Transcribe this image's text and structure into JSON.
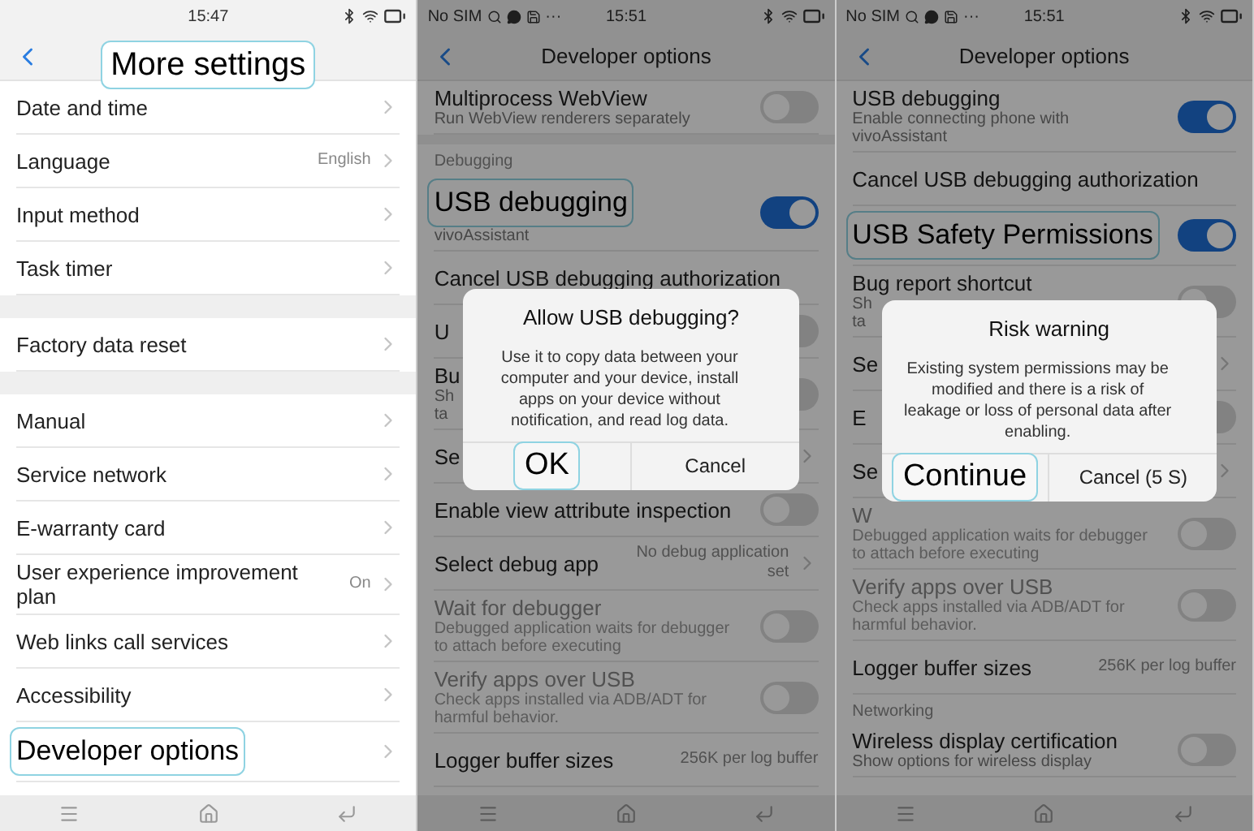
{
  "panels": [
    {
      "status": {
        "time": "15:47"
      },
      "header": {
        "title": "More settings",
        "highlighted": true
      },
      "dimmed": false,
      "rows": [
        {
          "kind": "link",
          "title": "Date and time"
        },
        {
          "kind": "link",
          "title": "Language",
          "value": "English"
        },
        {
          "kind": "link",
          "title": "Input method"
        },
        {
          "kind": "link",
          "title": "Task timer"
        },
        {
          "kind": "spacer"
        },
        {
          "kind": "link",
          "title": "Factory data reset"
        },
        {
          "kind": "spacer"
        },
        {
          "kind": "link",
          "title": "Manual"
        },
        {
          "kind": "link",
          "title": "Service network"
        },
        {
          "kind": "link",
          "title": "E-warranty card"
        },
        {
          "kind": "link",
          "title": "User experience improvement plan",
          "value": "On"
        },
        {
          "kind": "link",
          "title": "Web links call services"
        },
        {
          "kind": "link",
          "title": "Accessibility"
        },
        {
          "kind": "link",
          "title": "Developer options",
          "highlighted": true
        }
      ]
    },
    {
      "status": {
        "carrier": "No SIM",
        "more": "···",
        "time": "15:51"
      },
      "header": {
        "title": "Developer options",
        "highlighted": false
      },
      "dimmed": true,
      "rows": [
        {
          "kind": "toggle",
          "title": "Multiprocess WebView",
          "subtitle": [
            "Run WebView renderers separately"
          ],
          "on": false,
          "disabled": false
        },
        {
          "kind": "spacer"
        },
        {
          "kind": "section",
          "title": "Debugging"
        },
        {
          "kind": "toggle",
          "title": "USB debugging",
          "subtitle": [
            "vivoAssistant"
          ],
          "on": true,
          "disabled": false,
          "highlighted": true
        },
        {
          "kind": "plain",
          "title": "Cancel USB debugging authorization",
          "disabled": false
        },
        {
          "kind": "toggle",
          "title": "U",
          "on": false,
          "disabled": false
        },
        {
          "kind": "toggle",
          "title": "Bu",
          "subtitle": [
            "Sh",
            "ta"
          ],
          "on": false,
          "disabled": false
        },
        {
          "kind": "link",
          "title": "Se",
          "disabled": false
        },
        {
          "kind": "toggle",
          "title": "Enable view attribute inspection",
          "on": false,
          "disabled": false
        },
        {
          "kind": "link",
          "title": "Select debug app",
          "value": "No debug application set",
          "disabled": false
        },
        {
          "kind": "toggle",
          "title": "Wait for debugger",
          "subtitle": [
            "Debugged application waits for debugger",
            "to attach before executing"
          ],
          "on": false,
          "disabled": true
        },
        {
          "kind": "toggle",
          "title": "Verify apps over USB",
          "subtitle": [
            "Check apps installed via ADB/ADT for",
            "harmful behavior."
          ],
          "on": false,
          "disabled": true
        },
        {
          "kind": "info",
          "title": "Logger buffer sizes",
          "value": "256K per log buffer",
          "disabled": false
        }
      ],
      "dialog": {
        "title": "Allow USB debugging?",
        "body": "Use it to copy data between your computer and your device, install apps on your device without notification, and read log data.",
        "buttons": [
          {
            "label": "OK",
            "highlighted": true
          },
          {
            "label": "Cancel",
            "highlighted": false
          }
        ]
      }
    },
    {
      "status": {
        "carrier": "No SIM",
        "more": "···",
        "time": "15:51"
      },
      "header": {
        "title": "Developer options",
        "highlighted": false
      },
      "dimmed": true,
      "rows": [
        {
          "kind": "toggle",
          "title": "USB debugging",
          "subtitle": [
            "Enable connecting phone with",
            "vivoAssistant"
          ],
          "on": true,
          "disabled": false
        },
        {
          "kind": "plain",
          "title": "Cancel USB debugging authorization",
          "disabled": false
        },
        {
          "kind": "toggle",
          "title": "USB Safety Permissions",
          "on": true,
          "disabled": false,
          "highlighted": true
        },
        {
          "kind": "toggle",
          "title": "Bug report shortcut",
          "subtitle": [
            "Sh",
            "ta"
          ],
          "on": false,
          "disabled": false
        },
        {
          "kind": "link",
          "title": "Se",
          "disabled": false
        },
        {
          "kind": "toggle",
          "title": "E",
          "on": false,
          "disabled": false
        },
        {
          "kind": "link",
          "title": "Se",
          "disabled": false
        },
        {
          "kind": "toggle",
          "title": "W",
          "subtitle": [
            "Debugged application waits for debugger",
            "to attach before executing"
          ],
          "on": false,
          "disabled": true
        },
        {
          "kind": "toggle",
          "title": "Verify apps over USB",
          "subtitle": [
            "Check apps installed via ADB/ADT for",
            "harmful behavior."
          ],
          "on": false,
          "disabled": true
        },
        {
          "kind": "info",
          "title": "Logger buffer sizes",
          "value": "256K per log buffer",
          "disabled": false
        },
        {
          "kind": "section",
          "title": "Networking"
        },
        {
          "kind": "toggle",
          "title": "Wireless display certification",
          "subtitle": [
            "Show options for wireless display"
          ],
          "on": false,
          "disabled": false
        }
      ],
      "dialog": {
        "title": "Risk warning",
        "body": "Existing system permissions may be modified and there is a risk of leakage or loss of personal data after enabling.",
        "buttons": [
          {
            "label": "Continue",
            "highlighted": true
          },
          {
            "label": "Cancel (5 S)",
            "highlighted": false
          }
        ]
      }
    }
  ]
}
